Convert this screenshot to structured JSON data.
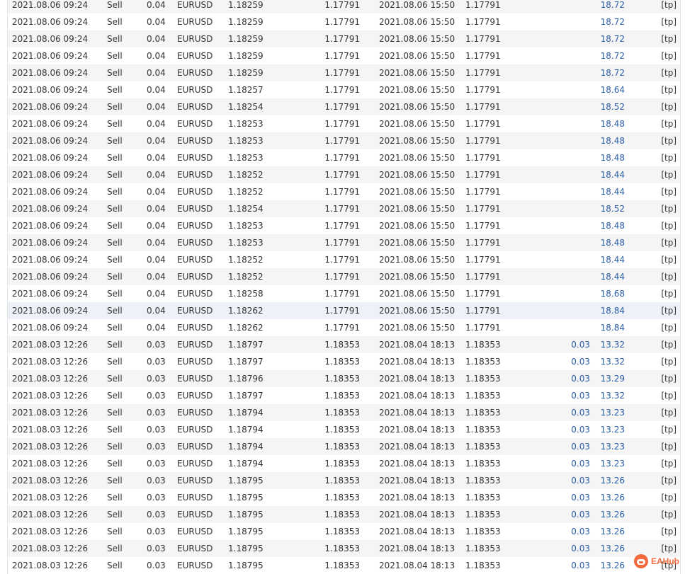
{
  "trades": [
    {
      "open_time": "2021.08.06 09:24",
      "type": "Sell",
      "volume": "0.04",
      "symbol": "EURUSD",
      "open_price": "1.18259",
      "sl": "1.17791",
      "close_time": "2021.08.06 15:50",
      "close_price": "1.17791",
      "swap": "",
      "profit": "18.72",
      "comment": "[tp]"
    },
    {
      "open_time": "2021.08.06 09:24",
      "type": "Sell",
      "volume": "0.04",
      "symbol": "EURUSD",
      "open_price": "1.18259",
      "sl": "1.17791",
      "close_time": "2021.08.06 15:50",
      "close_price": "1.17791",
      "swap": "",
      "profit": "18.72",
      "comment": "[tp]"
    },
    {
      "open_time": "2021.08.06 09:24",
      "type": "Sell",
      "volume": "0.04",
      "symbol": "EURUSD",
      "open_price": "1.18259",
      "sl": "1.17791",
      "close_time": "2021.08.06 15:50",
      "close_price": "1.17791",
      "swap": "",
      "profit": "18.72",
      "comment": "[tp]"
    },
    {
      "open_time": "2021.08.06 09:24",
      "type": "Sell",
      "volume": "0.04",
      "symbol": "EURUSD",
      "open_price": "1.18259",
      "sl": "1.17791",
      "close_time": "2021.08.06 15:50",
      "close_price": "1.17791",
      "swap": "",
      "profit": "18.72",
      "comment": "[tp]"
    },
    {
      "open_time": "2021.08.06 09:24",
      "type": "Sell",
      "volume": "0.04",
      "symbol": "EURUSD",
      "open_price": "1.18259",
      "sl": "1.17791",
      "close_time": "2021.08.06 15:50",
      "close_price": "1.17791",
      "swap": "",
      "profit": "18.72",
      "comment": "[tp]"
    },
    {
      "open_time": "2021.08.06 09:24",
      "type": "Sell",
      "volume": "0.04",
      "symbol": "EURUSD",
      "open_price": "1.18257",
      "sl": "1.17791",
      "close_time": "2021.08.06 15:50",
      "close_price": "1.17791",
      "swap": "",
      "profit": "18.64",
      "comment": "[tp]"
    },
    {
      "open_time": "2021.08.06 09:24",
      "type": "Sell",
      "volume": "0.04",
      "symbol": "EURUSD",
      "open_price": "1.18254",
      "sl": "1.17791",
      "close_time": "2021.08.06 15:50",
      "close_price": "1.17791",
      "swap": "",
      "profit": "18.52",
      "comment": "[tp]"
    },
    {
      "open_time": "2021.08.06 09:24",
      "type": "Sell",
      "volume": "0.04",
      "symbol": "EURUSD",
      "open_price": "1.18253",
      "sl": "1.17791",
      "close_time": "2021.08.06 15:50",
      "close_price": "1.17791",
      "swap": "",
      "profit": "18.48",
      "comment": "[tp]"
    },
    {
      "open_time": "2021.08.06 09:24",
      "type": "Sell",
      "volume": "0.04",
      "symbol": "EURUSD",
      "open_price": "1.18253",
      "sl": "1.17791",
      "close_time": "2021.08.06 15:50",
      "close_price": "1.17791",
      "swap": "",
      "profit": "18.48",
      "comment": "[tp]"
    },
    {
      "open_time": "2021.08.06 09:24",
      "type": "Sell",
      "volume": "0.04",
      "symbol": "EURUSD",
      "open_price": "1.18253",
      "sl": "1.17791",
      "close_time": "2021.08.06 15:50",
      "close_price": "1.17791",
      "swap": "",
      "profit": "18.48",
      "comment": "[tp]"
    },
    {
      "open_time": "2021.08.06 09:24",
      "type": "Sell",
      "volume": "0.04",
      "symbol": "EURUSD",
      "open_price": "1.18252",
      "sl": "1.17791",
      "close_time": "2021.08.06 15:50",
      "close_price": "1.17791",
      "swap": "",
      "profit": "18.44",
      "comment": "[tp]"
    },
    {
      "open_time": "2021.08.06 09:24",
      "type": "Sell",
      "volume": "0.04",
      "symbol": "EURUSD",
      "open_price": "1.18252",
      "sl": "1.17791",
      "close_time": "2021.08.06 15:50",
      "close_price": "1.17791",
      "swap": "",
      "profit": "18.44",
      "comment": "[tp]"
    },
    {
      "open_time": "2021.08.06 09:24",
      "type": "Sell",
      "volume": "0.04",
      "symbol": "EURUSD",
      "open_price": "1.18254",
      "sl": "1.17791",
      "close_time": "2021.08.06 15:50",
      "close_price": "1.17791",
      "swap": "",
      "profit": "18.52",
      "comment": "[tp]"
    },
    {
      "open_time": "2021.08.06 09:24",
      "type": "Sell",
      "volume": "0.04",
      "symbol": "EURUSD",
      "open_price": "1.18253",
      "sl": "1.17791",
      "close_time": "2021.08.06 15:50",
      "close_price": "1.17791",
      "swap": "",
      "profit": "18.48",
      "comment": "[tp]"
    },
    {
      "open_time": "2021.08.06 09:24",
      "type": "Sell",
      "volume": "0.04",
      "symbol": "EURUSD",
      "open_price": "1.18253",
      "sl": "1.17791",
      "close_time": "2021.08.06 15:50",
      "close_price": "1.17791",
      "swap": "",
      "profit": "18.48",
      "comment": "[tp]"
    },
    {
      "open_time": "2021.08.06 09:24",
      "type": "Sell",
      "volume": "0.04",
      "symbol": "EURUSD",
      "open_price": "1.18252",
      "sl": "1.17791",
      "close_time": "2021.08.06 15:50",
      "close_price": "1.17791",
      "swap": "",
      "profit": "18.44",
      "comment": "[tp]"
    },
    {
      "open_time": "2021.08.06 09:24",
      "type": "Sell",
      "volume": "0.04",
      "symbol": "EURUSD",
      "open_price": "1.18252",
      "sl": "1.17791",
      "close_time": "2021.08.06 15:50",
      "close_price": "1.17791",
      "swap": "",
      "profit": "18.44",
      "comment": "[tp]"
    },
    {
      "open_time": "2021.08.06 09:24",
      "type": "Sell",
      "volume": "0.04",
      "symbol": "EURUSD",
      "open_price": "1.18258",
      "sl": "1.17791",
      "close_time": "2021.08.06 15:50",
      "close_price": "1.17791",
      "swap": "",
      "profit": "18.68",
      "comment": "[tp]"
    },
    {
      "open_time": "2021.08.06 09:24",
      "type": "Sell",
      "volume": "0.04",
      "symbol": "EURUSD",
      "open_price": "1.18262",
      "sl": "1.17791",
      "close_time": "2021.08.06 15:50",
      "close_price": "1.17791",
      "swap": "",
      "profit": "18.84",
      "comment": "[tp]"
    },
    {
      "open_time": "2021.08.06 09:24",
      "type": "Sell",
      "volume": "0.04",
      "symbol": "EURUSD",
      "open_price": "1.18262",
      "sl": "1.17791",
      "close_time": "2021.08.06 15:50",
      "close_price": "1.17791",
      "swap": "",
      "profit": "18.84",
      "comment": "[tp]"
    },
    {
      "open_time": "2021.08.03 12:26",
      "type": "Sell",
      "volume": "0.03",
      "symbol": "EURUSD",
      "open_price": "1.18797",
      "sl": "1.18353",
      "close_time": "2021.08.04 18:13",
      "close_price": "1.18353",
      "swap": "0.03",
      "profit": "13.32",
      "comment": "[tp]"
    },
    {
      "open_time": "2021.08.03 12:26",
      "type": "Sell",
      "volume": "0.03",
      "symbol": "EURUSD",
      "open_price": "1.18797",
      "sl": "1.18353",
      "close_time": "2021.08.04 18:13",
      "close_price": "1.18353",
      "swap": "0.03",
      "profit": "13.32",
      "comment": "[tp]"
    },
    {
      "open_time": "2021.08.03 12:26",
      "type": "Sell",
      "volume": "0.03",
      "symbol": "EURUSD",
      "open_price": "1.18796",
      "sl": "1.18353",
      "close_time": "2021.08.04 18:13",
      "close_price": "1.18353",
      "swap": "0.03",
      "profit": "13.29",
      "comment": "[tp]"
    },
    {
      "open_time": "2021.08.03 12:26",
      "type": "Sell",
      "volume": "0.03",
      "symbol": "EURUSD",
      "open_price": "1.18797",
      "sl": "1.18353",
      "close_time": "2021.08.04 18:13",
      "close_price": "1.18353",
      "swap": "0.03",
      "profit": "13.32",
      "comment": "[tp]"
    },
    {
      "open_time": "2021.08.03 12:26",
      "type": "Sell",
      "volume": "0.03",
      "symbol": "EURUSD",
      "open_price": "1.18794",
      "sl": "1.18353",
      "close_time": "2021.08.04 18:13",
      "close_price": "1.18353",
      "swap": "0.03",
      "profit": "13.23",
      "comment": "[tp]"
    },
    {
      "open_time": "2021.08.03 12:26",
      "type": "Sell",
      "volume": "0.03",
      "symbol": "EURUSD",
      "open_price": "1.18794",
      "sl": "1.18353",
      "close_time": "2021.08.04 18:13",
      "close_price": "1.18353",
      "swap": "0.03",
      "profit": "13.23",
      "comment": "[tp]"
    },
    {
      "open_time": "2021.08.03 12:26",
      "type": "Sell",
      "volume": "0.03",
      "symbol": "EURUSD",
      "open_price": "1.18794",
      "sl": "1.18353",
      "close_time": "2021.08.04 18:13",
      "close_price": "1.18353",
      "swap": "0.03",
      "profit": "13.23",
      "comment": "[tp]"
    },
    {
      "open_time": "2021.08.03 12:26",
      "type": "Sell",
      "volume": "0.03",
      "symbol": "EURUSD",
      "open_price": "1.18794",
      "sl": "1.18353",
      "close_time": "2021.08.04 18:13",
      "close_price": "1.18353",
      "swap": "0.03",
      "profit": "13.23",
      "comment": "[tp]"
    },
    {
      "open_time": "2021.08.03 12:26",
      "type": "Sell",
      "volume": "0.03",
      "symbol": "EURUSD",
      "open_price": "1.18795",
      "sl": "1.18353",
      "close_time": "2021.08.04 18:13",
      "close_price": "1.18353",
      "swap": "0.03",
      "profit": "13.26",
      "comment": "[tp]"
    },
    {
      "open_time": "2021.08.03 12:26",
      "type": "Sell",
      "volume": "0.03",
      "symbol": "EURUSD",
      "open_price": "1.18795",
      "sl": "1.18353",
      "close_time": "2021.08.04 18:13",
      "close_price": "1.18353",
      "swap": "0.03",
      "profit": "13.26",
      "comment": "[tp]"
    },
    {
      "open_time": "2021.08.03 12:26",
      "type": "Sell",
      "volume": "0.03",
      "symbol": "EURUSD",
      "open_price": "1.18795",
      "sl": "1.18353",
      "close_time": "2021.08.04 18:13",
      "close_price": "1.18353",
      "swap": "0.03",
      "profit": "13.26",
      "comment": "[tp]"
    },
    {
      "open_time": "2021.08.03 12:26",
      "type": "Sell",
      "volume": "0.03",
      "symbol": "EURUSD",
      "open_price": "1.18795",
      "sl": "1.18353",
      "close_time": "2021.08.04 18:13",
      "close_price": "1.18353",
      "swap": "0.03",
      "profit": "13.26",
      "comment": "[tp]"
    },
    {
      "open_time": "2021.08.03 12:26",
      "type": "Sell",
      "volume": "0.03",
      "symbol": "EURUSD",
      "open_price": "1.18795",
      "sl": "1.18353",
      "close_time": "2021.08.04 18:13",
      "close_price": "1.18353",
      "swap": "0.03",
      "profit": "13.26",
      "comment": "[tp]"
    },
    {
      "open_time": "2021.08.03 12:26",
      "type": "Sell",
      "volume": "0.03",
      "symbol": "EURUSD",
      "open_price": "1.18795",
      "sl": "1.18353",
      "close_time": "2021.08.04 18:13",
      "close_price": "1.18353",
      "swap": "0.03",
      "profit": "13.26",
      "comment": "[tp]"
    }
  ],
  "highlighted_row": 18,
  "watermark": {
    "text": "EAHub",
    "icon": "eahub-logo-icon",
    "color": "#f26a3d"
  },
  "colors": {
    "value_blue": "#2a5da8",
    "row_alt": "#f5f5f5",
    "row_highlight": "#eef1f8"
  }
}
